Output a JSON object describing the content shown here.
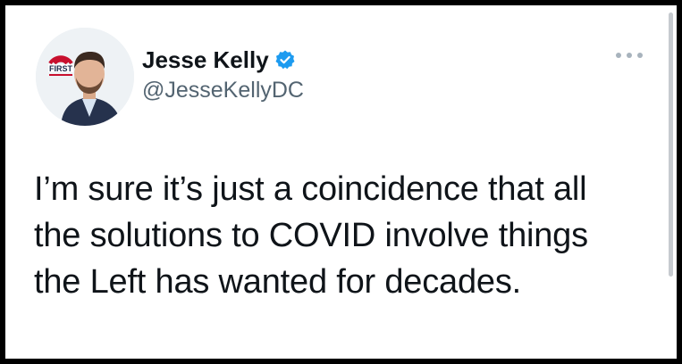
{
  "tweet": {
    "author": {
      "display_name": "Jesse Kelly",
      "handle": "@JesseKellyDC",
      "verified": true,
      "avatar_icon": "profile-photo-icon",
      "avatar_logo_text": "FIRST"
    },
    "text_lines": [
      "I’m sure it’s just a coincidence that all",
      "the solutions to COVID involve things",
      "the Left has wanted for decades."
    ],
    "more_icon": "more-options-icon"
  },
  "colors": {
    "verified": "#1d9bf0",
    "text": "#0f1419",
    "secondary": "#536471",
    "logo_red": "#c8102e",
    "logo_navy": "#1c2a4a"
  }
}
